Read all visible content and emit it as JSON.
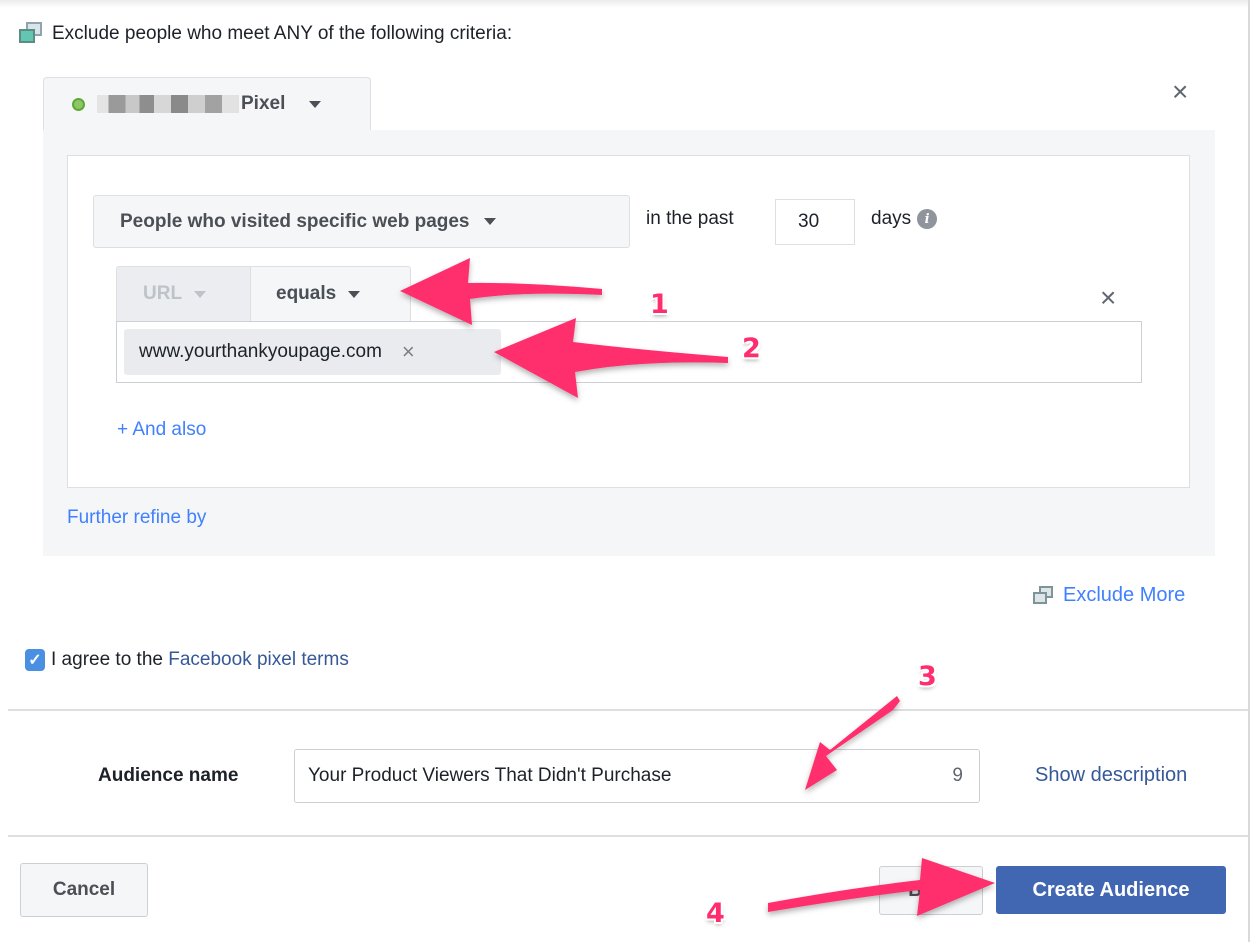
{
  "header": {
    "title": "Exclude people who meet ANY of the following criteria:",
    "icon": "copy-stack-icon"
  },
  "pixel_selector": {
    "status": "active",
    "status_color": "#8dc662",
    "name_suffix": "Pixel",
    "name_redacted": true
  },
  "rule": {
    "type_label": "People who visited specific web pages",
    "in_the_past_label": "in the past",
    "days_value": "30",
    "days_label": "days",
    "info_icon": "i",
    "field_label": "URL",
    "operator_label": "equals",
    "url_tokens": [
      {
        "value": "www.yourthankyoupage.com",
        "remove": "×"
      }
    ],
    "and_also": "+ And also"
  },
  "further_refine": "Further refine by",
  "exclude_more": "Exclude More",
  "agree": {
    "checked": true,
    "prefix": "I agree to the ",
    "link": "Facebook pixel terms",
    "check_glyph": "✓"
  },
  "audience": {
    "label": "Audience name",
    "value": "Your Product Viewers That Didn't Purchase",
    "remaining_chars": "9",
    "show_description": "Show description"
  },
  "footer": {
    "cancel": "Cancel",
    "back": "Back",
    "create": "Create Audience"
  },
  "close_glyph": "×",
  "annotations": {
    "color": "#ff2d6d",
    "steps": [
      "1",
      "2",
      "3",
      "4"
    ]
  }
}
